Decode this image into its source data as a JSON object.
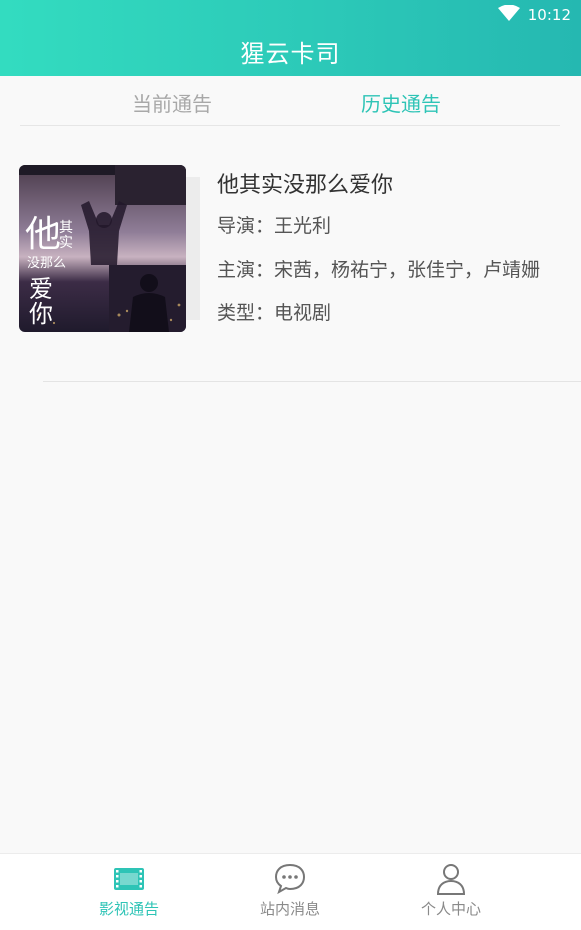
{
  "status_bar": {
    "time": "10:12"
  },
  "header": {
    "title": "猩云卡司"
  },
  "tabs": [
    {
      "label": "当前通告",
      "active": false
    },
    {
      "label": "历史通告",
      "active": true
    }
  ],
  "announcement": {
    "poster_text": {
      "line1": "他",
      "line2": "其实",
      "line3": "没那么",
      "line4": "爱你"
    },
    "title": "他其实没那么爱你",
    "director": "导演：王光利",
    "cast": "主演：宋茜，杨祐宁，张佳宁，卢靖姗",
    "genre": "类型：电视剧"
  },
  "bottom_nav": [
    {
      "label": "影视通告",
      "icon": "film-icon",
      "active": true
    },
    {
      "label": "站内消息",
      "icon": "chat-bubble-icon",
      "active": false
    },
    {
      "label": "个人中心",
      "icon": "person-icon",
      "active": false
    }
  ],
  "colors": {
    "accent": "#2ec4b6",
    "header_start": "#33dcc0",
    "header_end": "#25b8b1",
    "inactive": "#8a8a8a"
  }
}
